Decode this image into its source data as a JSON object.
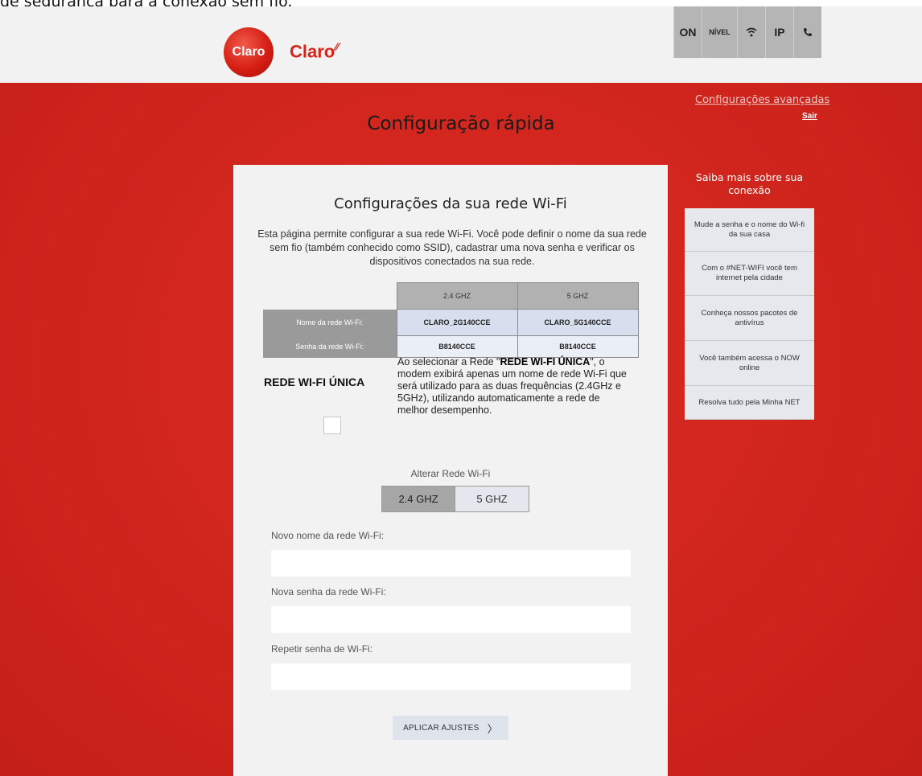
{
  "top_caption": "de segurança para a conexão sem fio.",
  "header": {
    "logo_badge": "Claro",
    "logo_text": "Claro",
    "status_buttons": [
      "ON",
      "NÍVEL",
      "wifi-icon",
      "IP",
      "phone-icon"
    ]
  },
  "links": {
    "advanced": "Configurações avançadas",
    "logout": "Sair"
  },
  "page_title": "Configuração rápida",
  "panel": {
    "title": "Configurações da sua rede Wi-Fi",
    "description": "Esta página permite configurar a sua rede Wi-Fi. Você pode definir o nome da sua rede sem fio (também conhecido como SSID), cadastrar uma nova senha e verificar os dispositivos conectados na sua rede.",
    "table": {
      "headers": [
        "2.4 GHZ",
        "5 GHZ"
      ],
      "rows": [
        {
          "label": "Nome da rede Wi-Fi:",
          "values": [
            "CLARO_2G140CCE",
            "CLARO_5G140CCE"
          ]
        },
        {
          "label": "Senha da rede Wi-Fi:",
          "values": [
            "B8140CCE",
            "B8140CCE"
          ]
        }
      ]
    },
    "unique": {
      "label": "REDE WI-FI ÚNICA",
      "text_before": "Ao selecionar a Rede \"",
      "text_bold": "REDE WI-FI ÚNICA",
      "text_after": "\", o modem exibirá apenas um nome de rede Wi-Fi que será utilizado para as duas frequências (2.4GHz e 5GHz), utilizando automaticamente a rede de melhor desempenho.",
      "checked": false
    },
    "alter_label": "Alterar Rede Wi-Fi",
    "bands": [
      "2.4 GHZ",
      "5 GHZ"
    ],
    "selected_band": "2.4 GHZ",
    "fields": {
      "ssid_label": "Novo nome da rede Wi-Fi:",
      "ssid_value": "",
      "password_label": "Nova senha da rede Wi-Fi:",
      "password_value": "",
      "repeat_label": "Repetir senha de Wi-Fi:",
      "repeat_value": ""
    },
    "apply_button": "APLICAR AJUSTES"
  },
  "sidebar": {
    "title": "Saiba mais sobre sua conexão",
    "items": [
      "Mude a senha e o nome do Wi-fi da sua casa",
      "Com o #NET-WIFI você tem internet pela cidade",
      "Conheça nossos pacotes de antivírus",
      "Você também acessa o NOW online",
      "Resolva tudo pela Minha NET"
    ]
  },
  "colors": {
    "brand_red": "#d0251d",
    "panel_bg": "#f2f2f2",
    "header_bg": "#f2f2f2"
  }
}
